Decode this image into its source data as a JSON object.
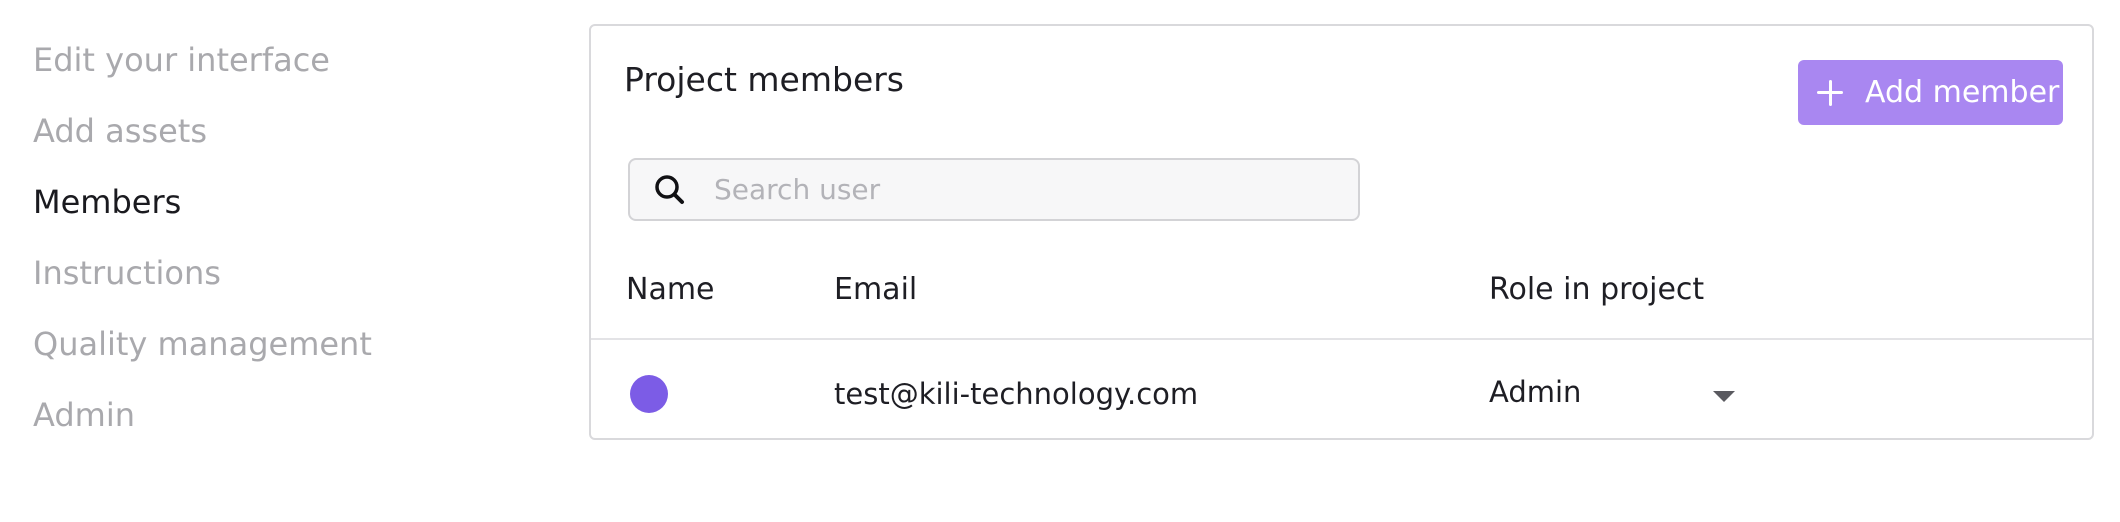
{
  "sidebar": {
    "items": [
      {
        "label": "Edit your interface"
      },
      {
        "label": "Add assets"
      },
      {
        "label": "Members"
      },
      {
        "label": "Instructions"
      },
      {
        "label": "Quality management"
      },
      {
        "label": "Admin"
      }
    ],
    "active": "Members"
  },
  "members_card": {
    "title": "Project members",
    "add_button_label": "Add member",
    "search_placeholder": "Search user",
    "search_value": "",
    "columns": [
      "Name",
      "Email",
      "Role in project"
    ],
    "rows": [
      {
        "name": "",
        "email": "test@kili-technology.com",
        "role": "Admin",
        "avatar_color": "#7c5ce6"
      }
    ]
  },
  "colors": {
    "accent": "#a987f1",
    "avatar": "#7c5ce6",
    "inactive_text": "#a9a9ad"
  },
  "icons": {
    "add": "plus-icon",
    "search": "search-icon",
    "role_dropdown": "caret-down-icon"
  }
}
